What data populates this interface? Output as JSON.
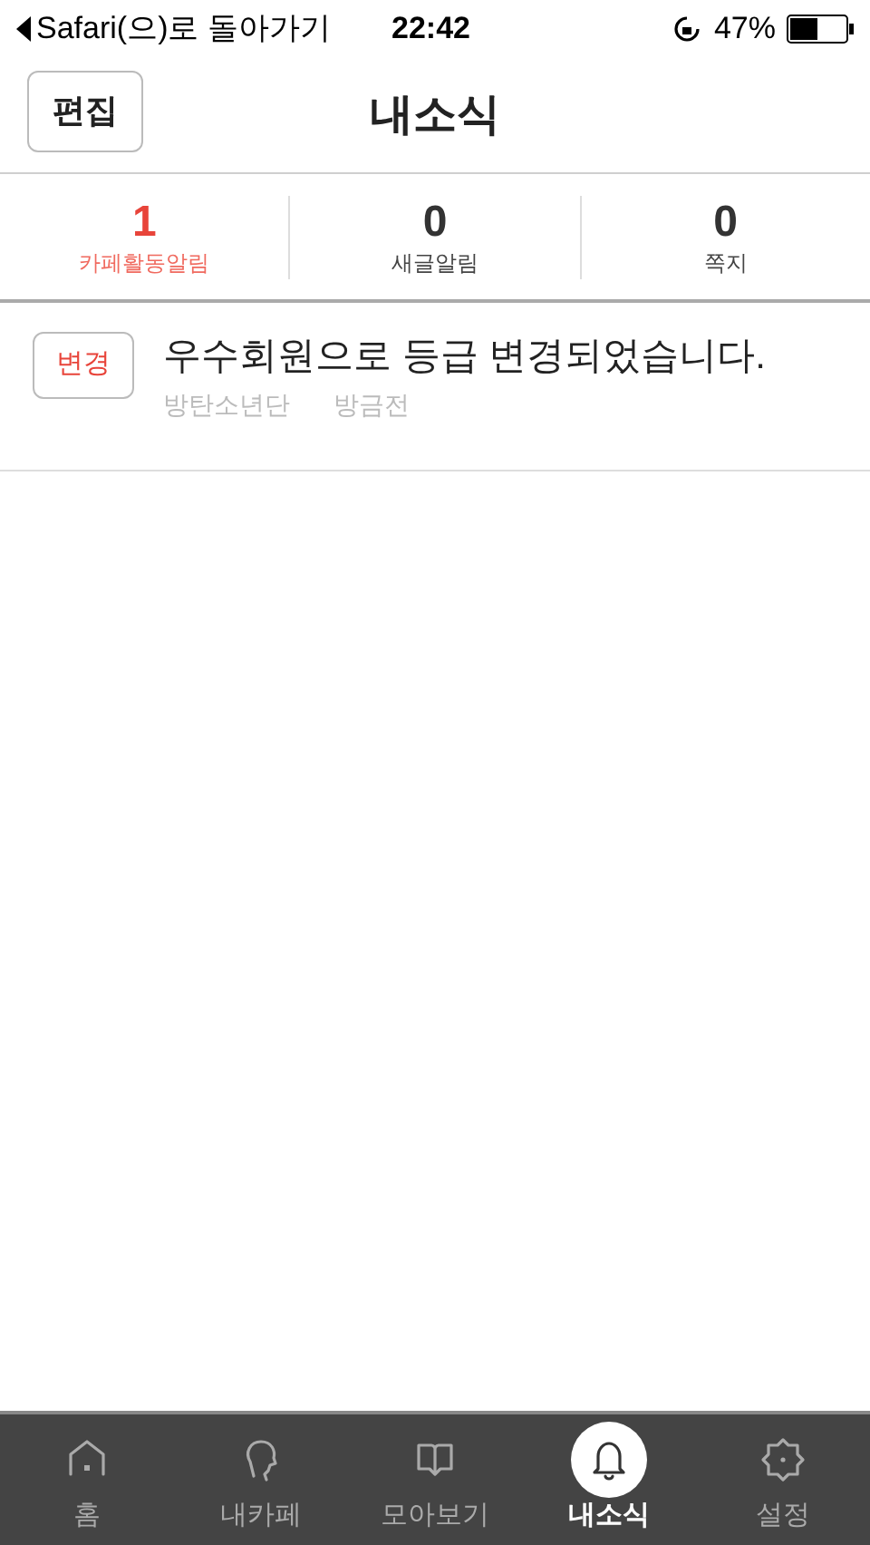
{
  "status_bar": {
    "back": "Safari(으)로 돌아가기",
    "time": "22:42",
    "battery": "47%"
  },
  "header": {
    "edit_button": "편집",
    "title": "내소식"
  },
  "counters": [
    {
      "count": "1",
      "label": "카페활동알림",
      "selected": true
    },
    {
      "count": "0",
      "label": "새글알림",
      "selected": false
    },
    {
      "count": "0",
      "label": "쪽지",
      "selected": false
    }
  ],
  "notifications": [
    {
      "badge": "변경",
      "message": "우수회원으로 등급 변경되었습니다.",
      "cafe": "방탄소년단",
      "time": "방금전"
    }
  ],
  "tab_bar": [
    {
      "kind": "home",
      "label": "홈",
      "selected": false
    },
    {
      "kind": "person",
      "label": "내카페",
      "selected": false
    },
    {
      "kind": "book",
      "label": "모아보기",
      "selected": false
    },
    {
      "kind": "bell",
      "label": "내소식",
      "selected": true
    },
    {
      "kind": "gear",
      "label": "설정",
      "selected": false
    }
  ]
}
